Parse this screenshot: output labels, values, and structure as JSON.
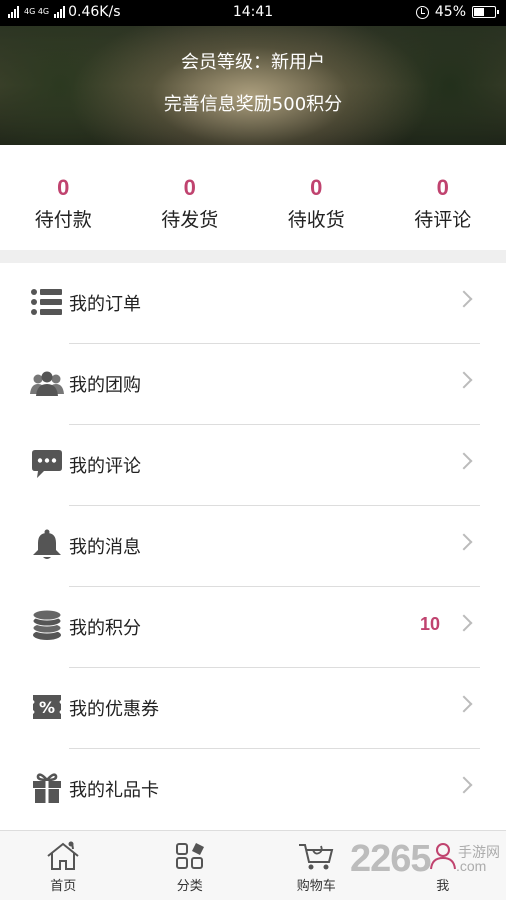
{
  "status_bar": {
    "net_type": "4G 4G",
    "speed": "0.46K/s",
    "time": "14:41",
    "battery": "45%",
    "battery_level": 0.45
  },
  "banner": {
    "member_level": "会员等级：新用户",
    "reward_text": "完善信息奖励500积分"
  },
  "order_counts": [
    {
      "count": "0",
      "label": "待付款"
    },
    {
      "count": "0",
      "label": "待发货"
    },
    {
      "count": "0",
      "label": "待收货"
    },
    {
      "count": "0",
      "label": "待评论"
    }
  ],
  "menu": [
    {
      "label": "我的订单",
      "icon": "list-icon"
    },
    {
      "label": "我的团购",
      "icon": "group-icon"
    },
    {
      "label": "我的评论",
      "icon": "comment-icon"
    },
    {
      "label": "我的消息",
      "icon": "bell-icon"
    },
    {
      "label": "我的积分",
      "icon": "coins-icon",
      "value": "10"
    },
    {
      "label": "我的优惠券",
      "icon": "coupon-icon"
    },
    {
      "label": "我的礼品卡",
      "icon": "gift-icon"
    }
  ],
  "tabs": [
    {
      "label": "首页",
      "icon": "home-icon"
    },
    {
      "label": "分类",
      "icon": "category-icon"
    },
    {
      "label": "购物车",
      "icon": "cart-icon"
    },
    {
      "label": "我",
      "icon": "user-icon"
    }
  ],
  "watermark": {
    "brand": "2265",
    "suffix": "手游网",
    "domain": ".com"
  },
  "colors": {
    "accent": "#c0436f",
    "icon": "#555555"
  }
}
